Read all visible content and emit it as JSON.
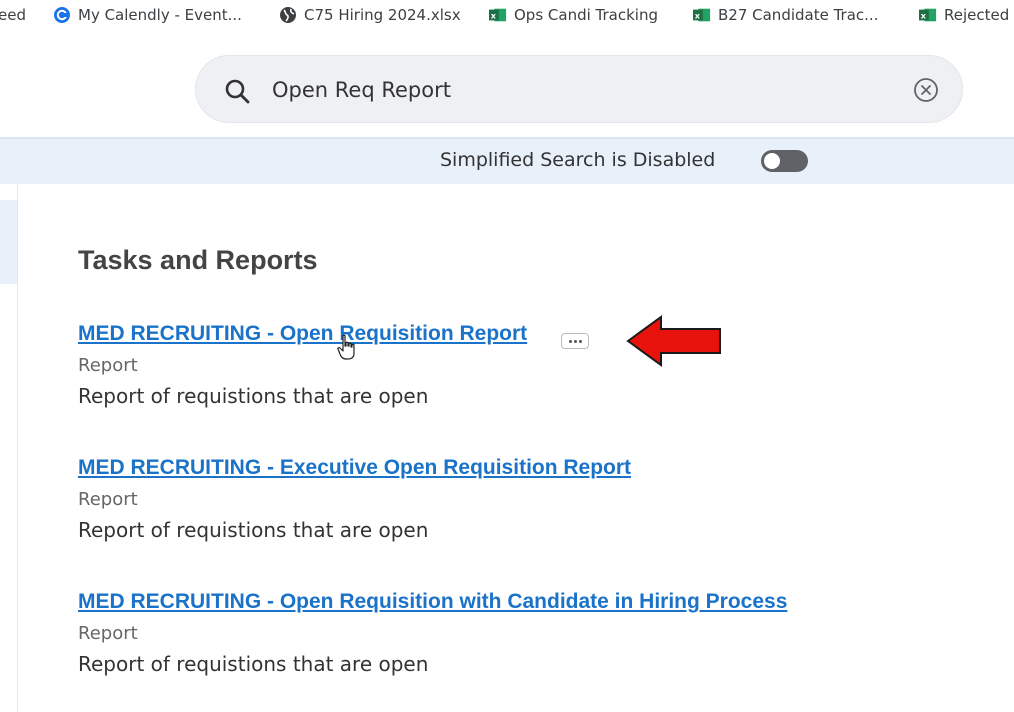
{
  "bookmarks": [
    {
      "label": "eed",
      "icon": "none"
    },
    {
      "label": "My Calendly - Event...",
      "icon": "calendly-icon"
    },
    {
      "label": "C75 Hiring 2024.xlsx",
      "icon": "globe-icon"
    },
    {
      "label": "Ops Candi Tracking",
      "icon": "excel-icon"
    },
    {
      "label": "B27 Candidate Trac...",
      "icon": "excel-icon"
    },
    {
      "label": "Rejected",
      "icon": "excel-icon"
    }
  ],
  "search": {
    "value": "Open Req Report",
    "placeholder": "Search"
  },
  "simplified_search": {
    "label": "Simplified Search is Disabled",
    "enabled": false
  },
  "section": {
    "title": "Tasks and Reports"
  },
  "results": [
    {
      "title": "MED RECRUITING - Open Requisition Report",
      "type": "Report",
      "description": "Report of requistions that are open"
    },
    {
      "title": "MED RECRUITING - Executive Open Requisition Report",
      "type": "Report",
      "description": "Report of requistions that are open"
    },
    {
      "title": "MED RECRUITING - Open Requisition with Candidate in Hiring Process",
      "type": "Report",
      "description": "Report of requistions that are open"
    }
  ],
  "colors": {
    "link": "#1a73c8",
    "arrow": "#e8120c",
    "banner": "#e8f0fa",
    "excel": "#1e7145",
    "calendly": "#1a73e8"
  }
}
